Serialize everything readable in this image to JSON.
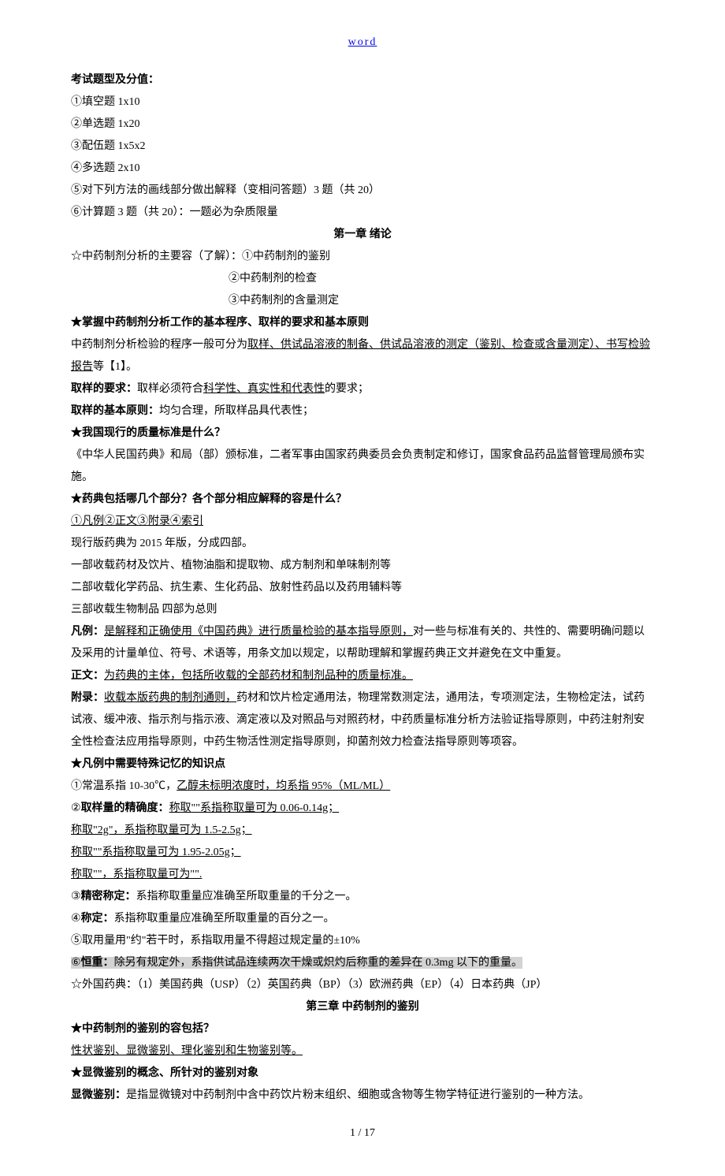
{
  "header": {
    "link_text": "word"
  },
  "section_exam": {
    "title": "考试题型及分值：",
    "items": [
      "①填空题 1x10",
      "②单选题 1x20",
      "③配伍题 1x5x2",
      "④多选题 2x10",
      "⑤对下列方法的画线部分做出解释（变相问答题）3 题（共 20）",
      "⑥计算题 3 题（共 20）：一题必为杂质限量"
    ]
  },
  "chapter1": {
    "title": "第一章  绪论",
    "main_content_intro": "☆中药制剂分析的主要容（了解）：①中药制剂的鉴别",
    "main_content_2": "②中药制剂的检查",
    "main_content_3": "③中药制剂的含量测定",
    "heading_basic": "★掌握中药制剂分析工作的基本程序、取样的要求和基本原则",
    "proc_pre": "中药制剂分析检验的程序一般可分为",
    "proc_underlined": "取样、供试品溶液的制备、供试品溶液的测定（鉴别、检查或含量测定）、书写检验报告",
    "proc_post": "等【1】。",
    "sample_req_pre": "取样的要求：",
    "sample_req_mid": "取样必须符合",
    "sample_req_u": "科学性、真实性和代表性",
    "sample_req_post": "的要求；",
    "sample_prin_pre": "取样的基本原则：",
    "sample_prin_post": "均匀合理，所取样品具代表性；",
    "heading_std": "★我国现行的质量标准是什么？",
    "std_text": "《中华人民国药典》和局（部）颁标准，二者军事由国家药典委员会负责制定和修订，国家食品药品监督管理局颁布实施。",
    "heading_pharma": "★药典包括哪几个部分？各个部分相应解释的容是什么？",
    "pharma_parts": "①凡例②正文③附录④索引",
    "pharma_ver": "现行版药典为 2015 年版，分成四部。",
    "pharma_p1": "一部收载药材及饮片、植物油脂和提取物、成方制剂和单味制剂等",
    "pharma_p2": "二部收载化学药品、抗生素、生化药品、放射性药品以及药用辅料等",
    "pharma_p3": "三部收载生物制品   四部为总则",
    "fanli_pre": "凡例：",
    "fanli_u": "是解释和正确使用《中国药典》进行质量检验的基本指导原则，",
    "fanli_post": "对一些与标准有关的、共性的、需要明确问题以及采用的计量单位、符号、术语等，用条文加以规定，以帮助理解和掌握药典正文并避免在文中重复。",
    "zhengwen_pre": "正文：",
    "zhengwen_u": "为药典的主体，包括所收载的全部药材和制剂品种的质量标准。",
    "fulu_pre": "附录：",
    "fulu_u": "收载本版药典的制剂通则，",
    "fulu_post": "药材和饮片检定通用法，物理常数测定法，通用法，专项测定法，生物检定法，试药试液、缓冲液、指示剂与指示液、滴定液以及对照品与对照药材，中药质量标准分析方法验证指导原则，中药注射剂安全性检查法应用指导原则，中药生物活性测定指导原则，抑菌剂效力检查法指导原则等项容。",
    "heading_special": "★凡例中需要特殊记忆的知识点",
    "sp1_pre": "①常温系指 10-30℃，",
    "sp1_u": "乙醇未标明浓度时，均系指 95%（ML/ML）",
    "sp2_pre": "②",
    "sp2_bold": "取样量的精确度：",
    "sp2_u": "称取\"\"系指称取量可为 0.06-0.14g；",
    "sp3": "称取\"2g\"，系指称取量可为 1.5-2.5g；",
    "sp4": "称取\"\"系指称取量可为 1.95-2.05g；",
    "sp5": "称取\"\"，系指称取量可为\"\".",
    "sp6_pre": "③",
    "sp6_bold": "精密称定：",
    "sp6_post": "系指称取重量应准确至所取重量的千分之一。",
    "sp7_pre": "④",
    "sp7_bold": "称定：",
    "sp7_post": "系指称取重量应准确至所取重量的百分之一。",
    "sp8": "⑤取用量用\"约\"若干时，系指取用量不得超过规定量的±10%",
    "sp9_pre": "⑥",
    "sp9_bold": "恒重：",
    "sp9_post": "除另有规定外，系指供试品连续两次干燥或炽灼后称重的差异在 0.3mg 以下的重量。",
    "foreign": "☆外国药典：（1）美国药典（USP）（2）英国药典（BP）（3）欧洲药典（EP）（4）日本药典（JP）"
  },
  "chapter3": {
    "title": "第三章 中药制剂的鉴别",
    "h1": "★中药制剂的鉴别的容包括？",
    "t1": "性状鉴别、显微鉴别、理化鉴别和生物鉴别等。",
    "h2": "★显微鉴别的概念、所针对的鉴别对象",
    "t2_pre": "显微鉴别：",
    "t2_post": "是指显微镜对中药制剂中含中药饮片粉末组织、细胞或含物等生物学特征进行鉴别的一种方法。"
  },
  "footer": {
    "page": "1 / 17"
  }
}
